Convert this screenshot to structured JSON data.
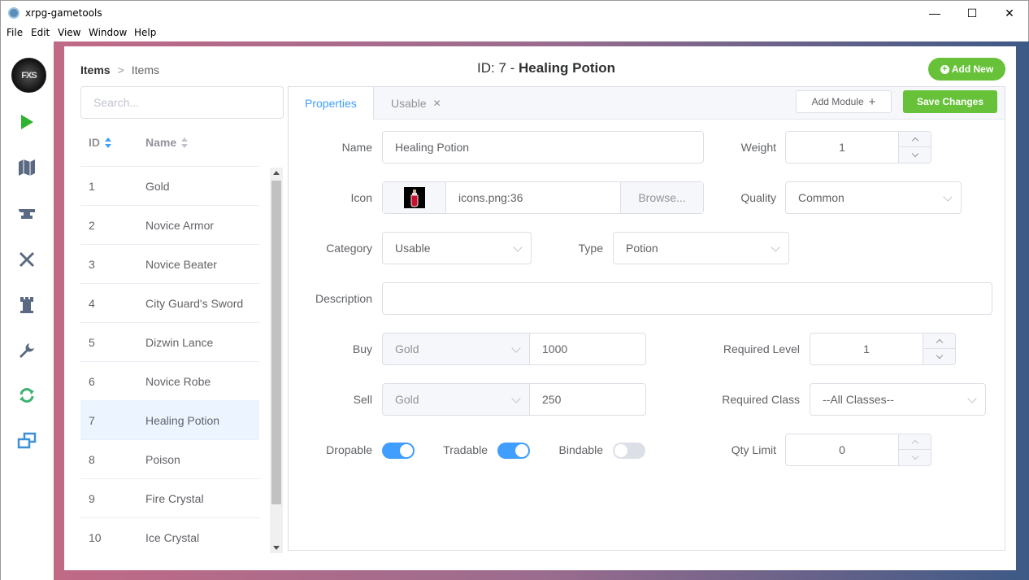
{
  "window": {
    "title": "xrpg-gametools",
    "minimize": "—",
    "maximize": "☐",
    "close": "✕"
  },
  "menu": [
    "File",
    "Edit",
    "View",
    "Window",
    "Help"
  ],
  "rail": {
    "logo": "FXS"
  },
  "header": {
    "breadcrumb": [
      "Items",
      "Items"
    ],
    "id_prefix": "ID: 7 -",
    "item_name": "Healing Potion",
    "add_new_label": "Add New"
  },
  "list": {
    "search_placeholder": "Search...",
    "columns": [
      "ID",
      "Name"
    ],
    "rows": [
      {
        "id": "1",
        "name": "Gold"
      },
      {
        "id": "2",
        "name": "Novice Armor"
      },
      {
        "id": "3",
        "name": "Novice Beater"
      },
      {
        "id": "4",
        "name": "City Guard's Sword"
      },
      {
        "id": "5",
        "name": "Dizwin Lance"
      },
      {
        "id": "6",
        "name": "Novice Robe"
      },
      {
        "id": "7",
        "name": "Healing Potion"
      },
      {
        "id": "8",
        "name": "Poison"
      },
      {
        "id": "9",
        "name": "Fire Crystal"
      },
      {
        "id": "10",
        "name": "Ice Crystal"
      }
    ],
    "selected_index": 6
  },
  "tabs": [
    {
      "label": "Properties",
      "active": true
    },
    {
      "label": "Usable",
      "closable": true
    }
  ],
  "toolbar": {
    "add_module": "Add Module",
    "save": "Save Changes"
  },
  "form": {
    "name": {
      "label": "Name",
      "value": "Healing Potion"
    },
    "weight": {
      "label": "Weight",
      "value": "1"
    },
    "icon": {
      "label": "Icon",
      "value": "icons.png:36",
      "browse": "Browse..."
    },
    "quality": {
      "label": "Quality",
      "value": "Common"
    },
    "category": {
      "label": "Category",
      "value": "Usable"
    },
    "type": {
      "label": "Type",
      "value": "Potion"
    },
    "description": {
      "label": "Description",
      "value": ""
    },
    "buy": {
      "label": "Buy",
      "currency": "Gold",
      "value": "1000"
    },
    "sell": {
      "label": "Sell",
      "currency": "Gold",
      "value": "250"
    },
    "required_level": {
      "label": "Required Level",
      "value": "1"
    },
    "required_class": {
      "label": "Required Class",
      "value": "--All Classes--"
    },
    "dropable": {
      "label": "Dropable",
      "on": true
    },
    "tradable": {
      "label": "Tradable",
      "on": true
    },
    "bindable": {
      "label": "Bindable",
      "on": false
    },
    "qty_limit": {
      "label": "Qty Limit",
      "value": "0"
    }
  },
  "colors": {
    "accent": "#409eff",
    "success": "#67c23a",
    "frame_left": "#c06a86",
    "frame_right": "#3d5a86"
  }
}
